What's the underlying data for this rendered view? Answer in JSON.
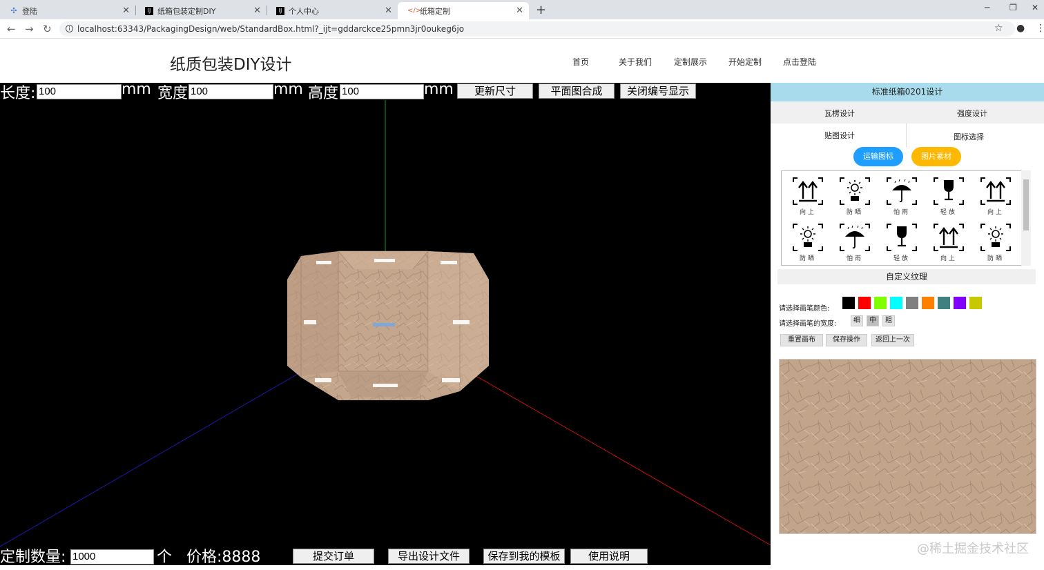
{
  "browser": {
    "tabs": [
      {
        "title": "登陆",
        "icon": "puzzle-icon"
      },
      {
        "title": "纸箱包装定制DIY",
        "icon": "intellij-icon"
      },
      {
        "title": "个人中心",
        "icon": "intellij-icon"
      },
      {
        "title": "纸箱定制",
        "icon": "code-icon"
      }
    ],
    "url": "localhost:63343/PackagingDesign/web/StandardBox.html?_ijt=gddarckce25pmn3jr0oukeg6jo"
  },
  "header": {
    "logo": "纸质包装DIY设计",
    "nav": [
      "首页",
      "关于我们",
      "定制展示",
      "开始定制",
      "点击登陆"
    ]
  },
  "dimensions": {
    "length_label": "长度:",
    "length_value": "100",
    "mm1": "mm",
    "width_label": "宽度:",
    "width_value": "100",
    "mm2": "mm",
    "height_label": "高度:",
    "height_value": "100",
    "mm3": "mm",
    "update_button": "更新尺寸",
    "compose_button": "平面图合成",
    "toggle_numbers_button": "关闭编号显示"
  },
  "order": {
    "quantity_label": "定制数量:",
    "quantity_value": "1000",
    "unit": "个",
    "price_label": "价格:8888",
    "submit_button": "提交订单",
    "export_button": "导出设计文件",
    "save_template_button": "保存到我的模板",
    "help_button": "使用说明"
  },
  "panel": {
    "title": "标准纸箱0201设计",
    "tabs": [
      "瓦楞设计",
      "强度设计",
      "贴图设计",
      "图标选择"
    ],
    "transport_icons_button": "运输图标",
    "image_material_button": "图片素材",
    "icons": [
      {
        "name": "up-arrows-icon",
        "caption": "向上"
      },
      {
        "name": "sun-icon",
        "caption": "防晒"
      },
      {
        "name": "umbrella-icon",
        "caption": "怕雨"
      },
      {
        "name": "fragile-glass-icon",
        "caption": "轻放"
      },
      {
        "name": "up-arrows-icon",
        "caption": "向上"
      },
      {
        "name": "sun-icon",
        "caption": "防晒"
      },
      {
        "name": "umbrella-icon",
        "caption": "怕雨"
      },
      {
        "name": "fragile-glass-icon",
        "caption": "轻放"
      },
      {
        "name": "up-arrows-icon",
        "caption": "向上"
      },
      {
        "name": "sun-icon",
        "caption": "防晒"
      }
    ],
    "texture_header": "自定义纹理",
    "brush_color_label": "请选择画笔颜色:",
    "brush_colors": [
      "#000000",
      "#ff0000",
      "#80ff00",
      "#00ffff",
      "#808080",
      "#ff8000",
      "#408080",
      "#8000ff",
      "#c8c800"
    ],
    "brush_width_label": "请选择画笔的宽度:",
    "brush_widths": [
      "细",
      "中",
      "粗"
    ],
    "reset_button": "重置画布",
    "save_op_button": "保存操作",
    "undo_button": "返回上一次"
  },
  "watermark": "@稀土掘金技术社区"
}
